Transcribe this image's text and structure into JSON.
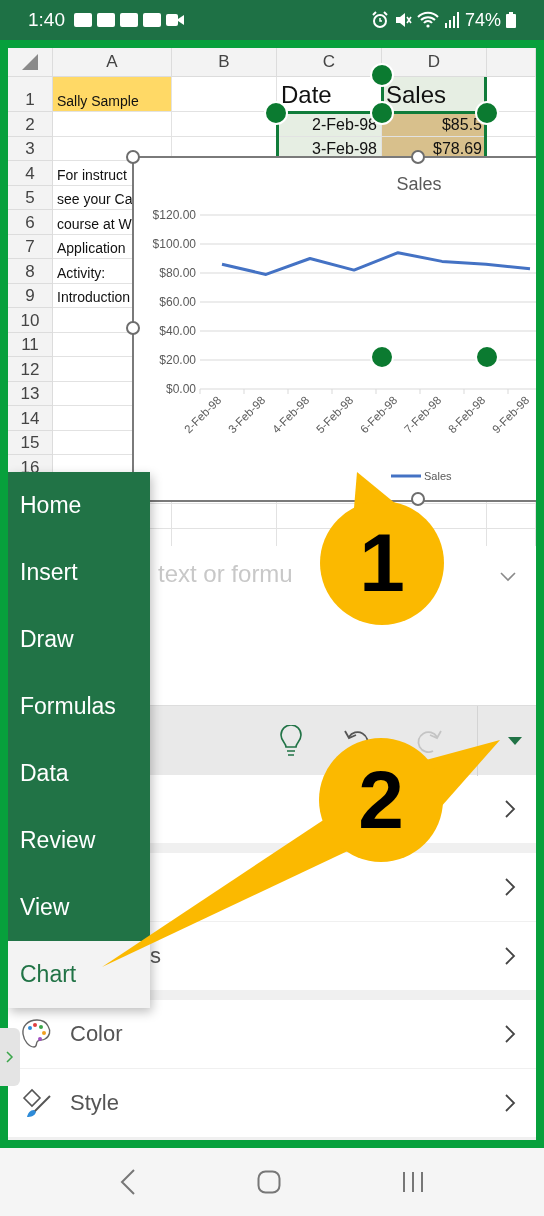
{
  "status_bar": {
    "time": "1:40",
    "battery": "74%"
  },
  "sheet": {
    "columns": [
      "A",
      "B",
      "C",
      "D"
    ],
    "rows": [
      {
        "label": "1",
        "a": {
          "text": "Sally Sample",
          "color": "#ffd966"
        },
        "c": {
          "text": "Date"
        },
        "d": {
          "text": "Sales",
          "color": "#e6eee3"
        }
      },
      {
        "label": "2",
        "c": {
          "text": "2-Feb-98",
          "color": "#e6eee3"
        },
        "d": {
          "text": "$85.5",
          "color": "#d8c08c"
        }
      },
      {
        "label": "3",
        "c": {
          "text": "3-Feb-98",
          "color": "#e6eee3"
        },
        "d": {
          "text": "$78.69",
          "color": "#d8c08c"
        }
      },
      {
        "label": "4",
        "a": {
          "text": "For instruct"
        }
      },
      {
        "label": "5",
        "a": {
          "text": "see your Ca"
        }
      },
      {
        "label": "6",
        "a": {
          "text": "course at W"
        }
      },
      {
        "label": "7",
        "a": {
          "text": "Application"
        }
      },
      {
        "label": "8",
        "a": {
          "text": "Activity:"
        }
      },
      {
        "label": "9",
        "a": {
          "text": "Introduction"
        }
      },
      {
        "label": "10"
      },
      {
        "label": "11"
      },
      {
        "label": "12"
      },
      {
        "label": "13"
      },
      {
        "label": "14"
      },
      {
        "label": "15"
      },
      {
        "label": "16"
      }
    ]
  },
  "chart": {
    "chart_data": {
      "type": "line",
      "title": "Sales",
      "grid": true,
      "categories": [
        "2-Feb-98",
        "3-Feb-98",
        "4-Feb-98",
        "5-Feb-98",
        "6-Feb-98",
        "7-Feb-98",
        "8-Feb-98",
        "9-Feb-98"
      ],
      "series": [
        {
          "name": "Sales",
          "color": "#4472c4",
          "values": [
            86,
            79,
            90,
            82,
            94,
            88,
            86,
            83
          ]
        }
      ],
      "ylim": [
        0,
        120
      ],
      "yticks": [
        {
          "value": 0,
          "label": "$0.00"
        },
        {
          "value": 20,
          "label": "$20.00"
        },
        {
          "value": 40,
          "label": "$40.00"
        },
        {
          "value": 60,
          "label": "$60.00"
        },
        {
          "value": 80,
          "label": "$80.00"
        },
        {
          "value": 100,
          "label": "$100.00"
        },
        {
          "value": 120,
          "label": "$120.00"
        }
      ]
    }
  },
  "formula_bar": {
    "placeholder": "text or formu"
  },
  "menu": {
    "items": [
      {
        "label": "Home",
        "selected": false
      },
      {
        "label": "Insert",
        "selected": false
      },
      {
        "label": "Draw",
        "selected": false
      },
      {
        "label": "Formulas",
        "selected": false
      },
      {
        "label": "Data",
        "selected": false
      },
      {
        "label": "Review",
        "selected": false
      },
      {
        "label": "View",
        "selected": false
      },
      {
        "label": "Chart",
        "selected": true
      }
    ]
  },
  "option_groups": [
    {
      "items": [
        {
          "kind": "plain"
        }
      ]
    },
    {
      "items": [
        {
          "kind": "plain"
        },
        {
          "kind": "plain",
          "label": "s"
        }
      ]
    },
    {
      "items": [
        {
          "kind": "color",
          "label": "Color"
        },
        {
          "kind": "style",
          "label": "Style"
        }
      ]
    }
  ],
  "callouts": [
    {
      "number": "1"
    },
    {
      "number": "2"
    }
  ]
}
